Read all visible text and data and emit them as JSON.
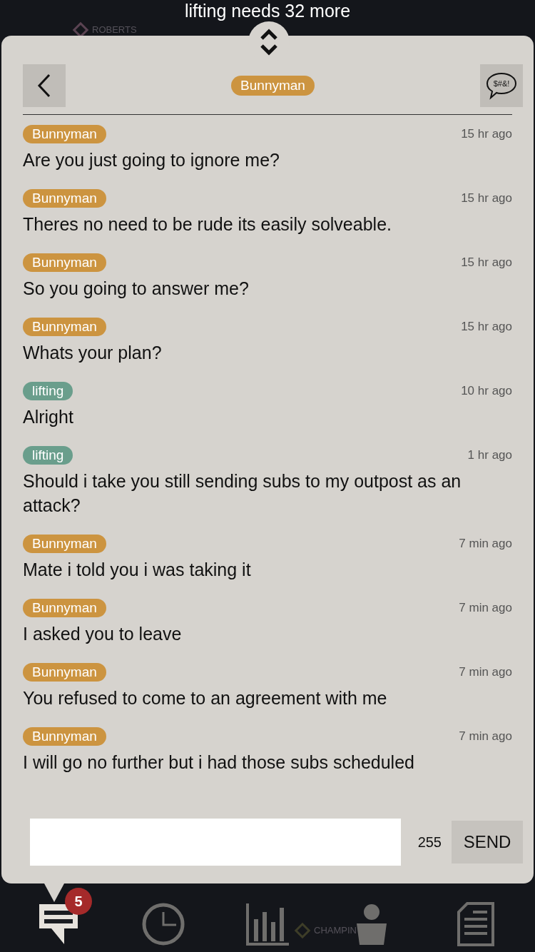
{
  "banner": {
    "line_1": "lifting needs 32 more"
  },
  "map_labels": [
    "ROBERTS",
    "CHAMPIN"
  ],
  "chat": {
    "title": "Bunnyman",
    "filter_icon_text": "$#&!",
    "messages": [
      {
        "author": "Bunnyman",
        "color": "#cc9440",
        "time": "15 hr ago",
        "text": "Are you just going to ignore me?"
      },
      {
        "author": "Bunnyman",
        "color": "#cc9440",
        "time": "15 hr ago",
        "text": "Theres no need to be rude its easily solveable."
      },
      {
        "author": "Bunnyman",
        "color": "#cc9440",
        "time": "15 hr ago",
        "text": "So you going to answer me?"
      },
      {
        "author": "Bunnyman",
        "color": "#cc9440",
        "time": "15 hr ago",
        "text": "Whats your plan?"
      },
      {
        "author": "lifting",
        "color": "#6a9e8c",
        "time": "10 hr ago",
        "text": "Alright"
      },
      {
        "author": "lifting",
        "color": "#6a9e8c",
        "time": "1 hr ago",
        "text": "Should i take you still sending subs to my outpost as an attack?"
      },
      {
        "author": "Bunnyman",
        "color": "#cc9440",
        "time": "7 min ago",
        "text": "Mate i told you i was taking it"
      },
      {
        "author": "Bunnyman",
        "color": "#cc9440",
        "time": "7 min ago",
        "text": "I asked you to leave"
      },
      {
        "author": "Bunnyman",
        "color": "#cc9440",
        "time": "7 min ago",
        "text": "You refused to come to an agreement with me"
      },
      {
        "author": "Bunnyman",
        "color": "#cc9440",
        "time": "7 min ago",
        "text": "I will go no further but i had those subs scheduled"
      }
    ],
    "char_count": "255",
    "send": "SEND"
  },
  "nav": [
    {
      "kind": "chat",
      "selected": true,
      "badge": "5"
    },
    {
      "kind": "clock",
      "selected": false
    },
    {
      "kind": "chart",
      "selected": false
    },
    {
      "kind": "person",
      "selected": false
    },
    {
      "kind": "document",
      "selected": false
    }
  ]
}
